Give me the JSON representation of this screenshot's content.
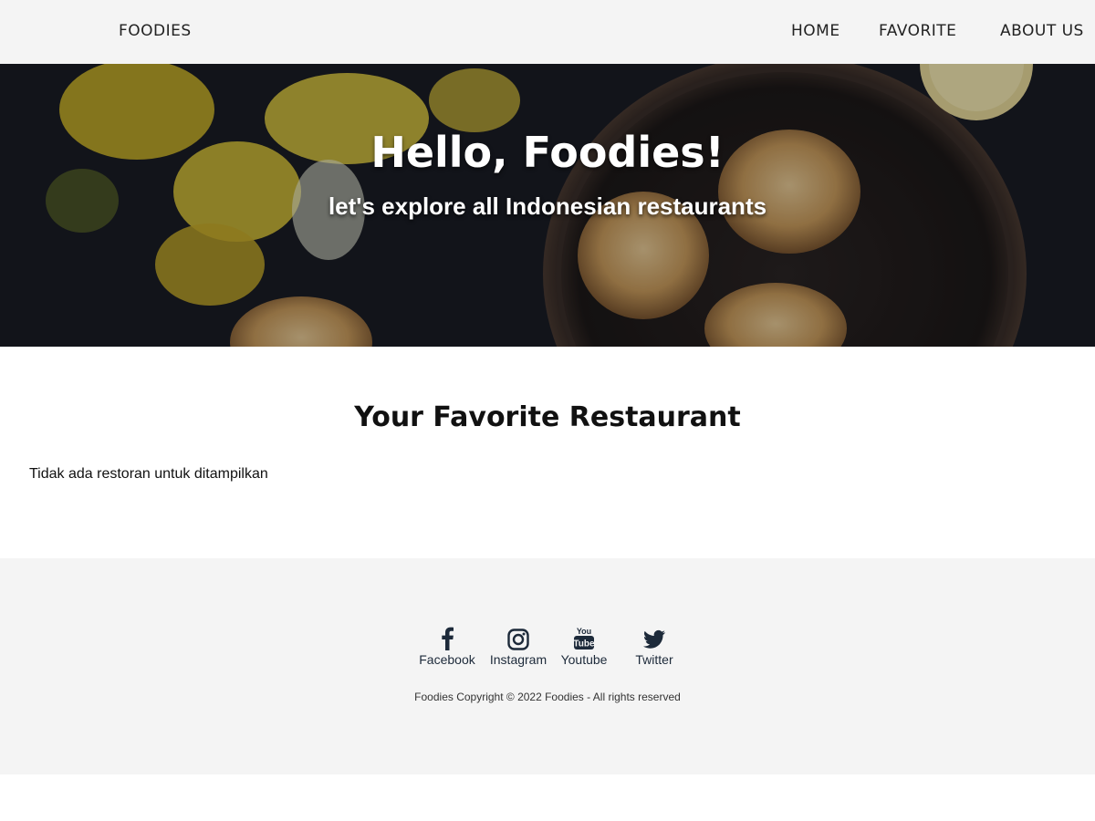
{
  "header": {
    "brand": "FOODIES",
    "nav": [
      {
        "label": "HOME"
      },
      {
        "label": "FAVORITE"
      },
      {
        "label": "ABOUT US"
      }
    ]
  },
  "hero": {
    "title": "Hello, Foodies!",
    "subtitle": "let's explore all Indonesian restaurants"
  },
  "main": {
    "title": "Your Favorite Restaurant",
    "empty_message": "Tidak ada restoran untuk ditampilkan"
  },
  "footer": {
    "social": [
      {
        "label": "Facebook",
        "icon": "facebook-icon"
      },
      {
        "label": "Instagram",
        "icon": "instagram-icon"
      },
      {
        "label": "Youtube",
        "icon": "youtube-icon"
      },
      {
        "label": "Twitter",
        "icon": "twitter-icon"
      }
    ],
    "copyright": "Foodies Copyright © 2022 Foodies - All rights reserved"
  },
  "colors": {
    "header_bg": "#f4f4f4",
    "footer_bg": "#f4f4f4",
    "icon_color": "#1d2a3a",
    "hero_dark": "#181a22"
  }
}
